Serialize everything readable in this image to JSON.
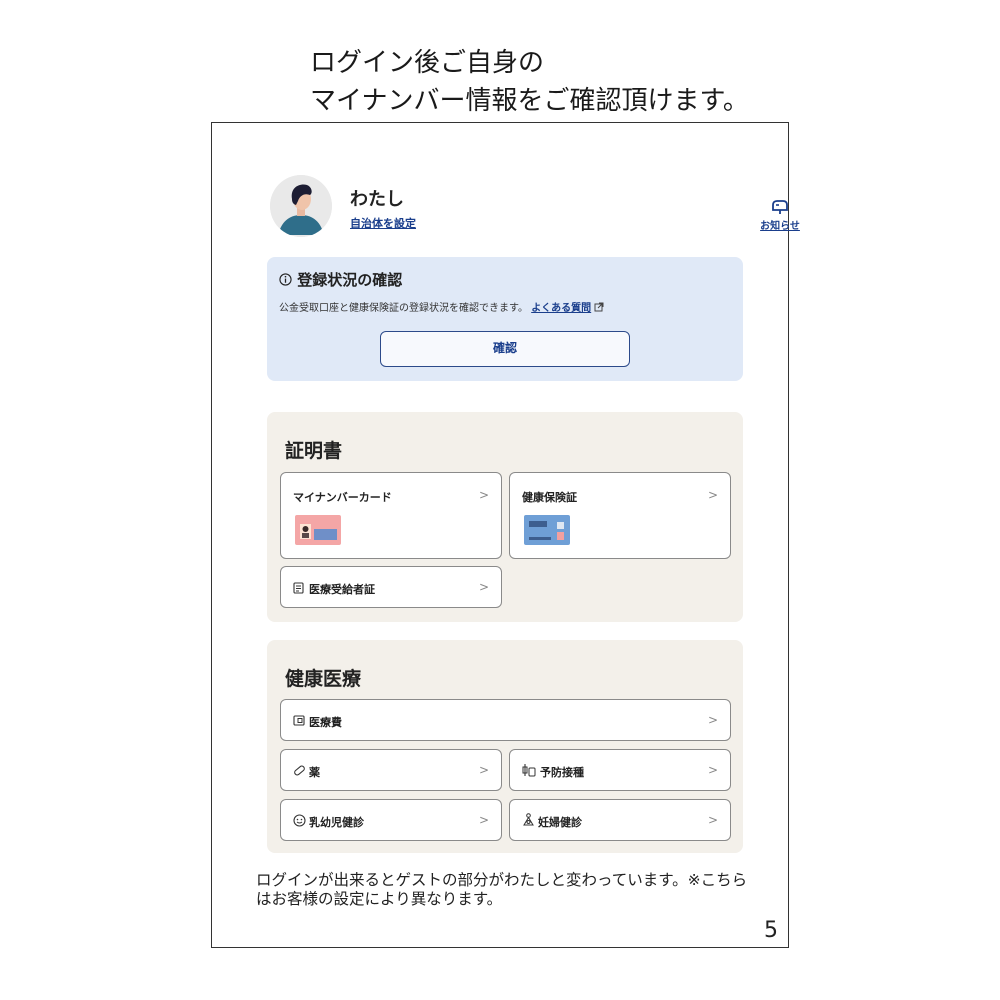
{
  "heading": {
    "line1": "ログイン後ご自身の",
    "line2": "マイナンバー情報をご確認頂けます。"
  },
  "profile": {
    "name": "わたし",
    "link": "自治体を設定",
    "notice_label": "お知らせ",
    "notice_icon": "mailbox-icon",
    "avatar_icon": "person-avatar"
  },
  "registration": {
    "icon": "info-circle-icon",
    "title": "登録状況の確認",
    "desc": "公金受取口座と健康保険証の登録状況を確認できます。",
    "faq_link": "よくある質問",
    "external_icon": "external-link-icon",
    "button": "確認"
  },
  "certificates": {
    "title": "証明書",
    "cards": [
      {
        "label": "マイナンバーカード",
        "icon": "mynumber-card-image"
      },
      {
        "label": "健康保険証",
        "icon": "insurance-card-image"
      },
      {
        "label": "医療受給者証",
        "icon": "document-icon"
      }
    ],
    "chevron": ">"
  },
  "healthcare": {
    "title": "健康医療",
    "items": [
      {
        "label": "医療費",
        "icon": "wallet-icon"
      },
      {
        "label": "薬",
        "icon": "pill-icon"
      },
      {
        "label": "予防接種",
        "icon": "vaccine-icon"
      },
      {
        "label": "乳幼児健診",
        "icon": "baby-face-icon"
      },
      {
        "label": "妊婦健診",
        "icon": "pregnant-icon"
      }
    ]
  },
  "footer_text": "ログインが出来るとゲストの部分がわたしと変わっています。※こちらはお客様の設定により異なります。",
  "page_number": "5",
  "colors": {
    "link": "#1a3e8c",
    "reg_bg": "#e0e9f7",
    "section_bg": "#f3f0ea"
  }
}
